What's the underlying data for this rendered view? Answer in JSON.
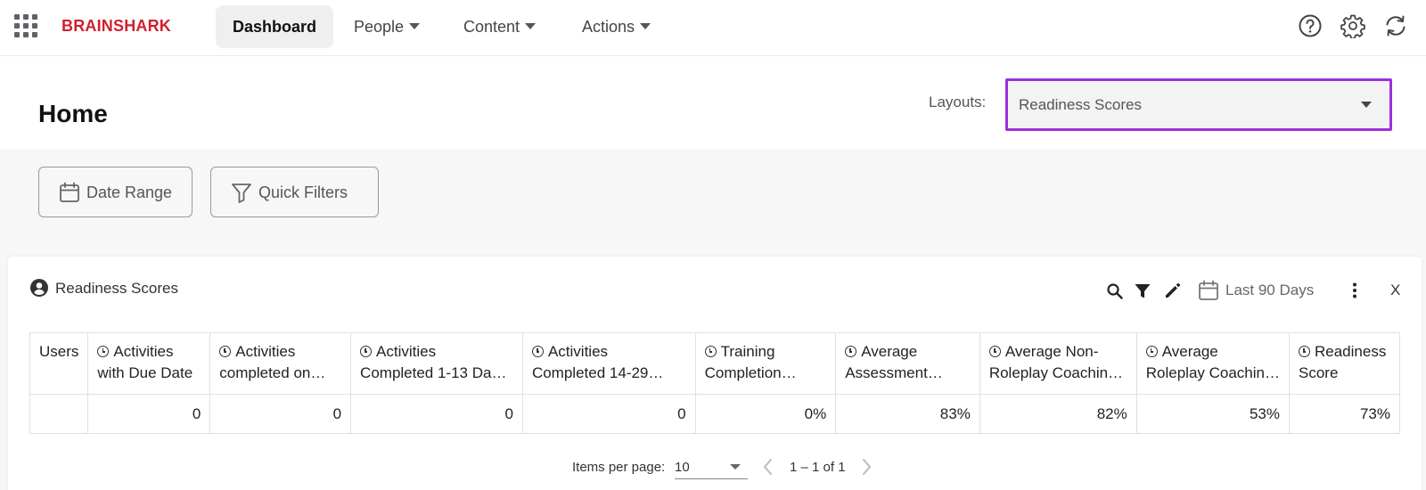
{
  "topnav": {
    "logo": "BRAINSHARK",
    "items": [
      {
        "label": "Dashboard",
        "active": true
      },
      {
        "label": "People"
      },
      {
        "label": "Content"
      },
      {
        "label": "Actions"
      }
    ],
    "icons": [
      "help-icon",
      "settings-icon",
      "sync-icon"
    ]
  },
  "header": {
    "title": "Home",
    "layouts_label": "Layouts:",
    "layout_value": "Readiness Scores"
  },
  "filters": {
    "date_range": "Date Range",
    "quick_filters": "Quick Filters"
  },
  "card": {
    "title": "Readiness Scores",
    "date_filter": "Last 90 Days",
    "close": "X",
    "tools": [
      "search-icon",
      "filter-icon",
      "edit-icon",
      "calendar-icon",
      "more-vertical-icon"
    ]
  },
  "table": {
    "headers": [
      "Users",
      "Activities with Due Date",
      "Activities completed on…",
      "Activities Completed 1-13 Da…",
      "Activities Completed 14-29…",
      "Training Completion…",
      "Average Assessment…",
      "Average Non-Roleplay Coachin…",
      "Average Roleplay Coachin…",
      "Readiness Score"
    ],
    "header_lines": [
      [
        "Users"
      ],
      [
        "Activities",
        "with Due Date"
      ],
      [
        "Activities",
        "completed on…"
      ],
      [
        "Activities",
        "Completed 1-13 Da…"
      ],
      [
        "Activities",
        "Completed 14-29…"
      ],
      [
        "Training",
        "Completion…"
      ],
      [
        "Average",
        "Assessment…"
      ],
      [
        "Average Non-",
        "Roleplay Coachin…"
      ],
      [
        "Average",
        "Roleplay Coachin…"
      ],
      [
        "Readiness",
        "Score"
      ]
    ],
    "row": [
      "",
      "0",
      "0",
      "0",
      "0",
      "0%",
      "83%",
      "82%",
      "53%",
      "73%"
    ]
  },
  "paginator": {
    "label": "Items per page:",
    "page_size": "10",
    "range": "1 – 1 of 1"
  },
  "colors": {
    "brand": "#d0202e",
    "focus": "#9b30d9",
    "band": "#f7f7f7"
  }
}
